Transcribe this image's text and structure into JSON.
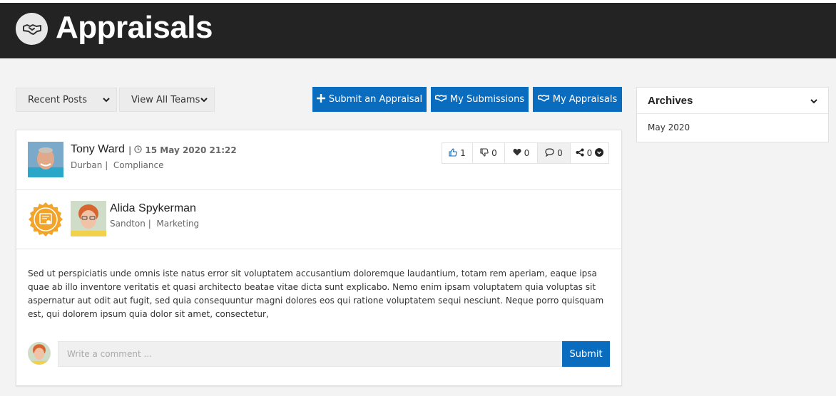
{
  "header": {
    "title": "Appraisals",
    "logo_icon": "handshake-icon",
    "background": "#232323"
  },
  "filters": {
    "posts_select": {
      "value": "Recent Posts"
    },
    "teams_select": {
      "value": "View All Teams"
    }
  },
  "actions": {
    "submit_appraisal": {
      "label": "Submit an Appraisal",
      "icon": "plus-icon"
    },
    "my_submissions": {
      "label": "My Submissions",
      "icon": "handshake-icon"
    },
    "my_appraisals": {
      "label": "My Appraisals",
      "icon": "handshake-icon"
    },
    "accent": "#0a6cbf"
  },
  "post": {
    "author": {
      "name": "Tony Ward",
      "separator": "|",
      "location": "Durban",
      "department": "Compliance"
    },
    "date": "15 May 2020 21:22",
    "reactions": {
      "like": {
        "count": "1",
        "icon": "thumbs-up-icon"
      },
      "dislike": {
        "count": "0",
        "icon": "thumbs-down-icon"
      },
      "love": {
        "count": "0",
        "icon": "heart-icon"
      },
      "comments": {
        "count": "0",
        "icon": "comment-icon"
      },
      "shares": {
        "count": "0",
        "icon": "share-icon"
      }
    },
    "recipient": {
      "name": "Alida Spykerman",
      "location": "Sandton",
      "department": "Marketing",
      "badge_icon": "award-badge-icon"
    },
    "body": "Sed ut perspiciatis unde omnis iste natus error sit voluptatem accusantium doloremque laudantium, totam rem aperiam, eaque ipsa quae ab illo inventore veritatis et quasi architecto beatae vitae dicta sunt explicabo. Nemo enim ipsam voluptatem quia voluptas sit aspernatur aut odit aut fugit, sed quia consequuntur magni dolores eos qui ratione voluptatem sequi nesciunt. Neque porro quisquam est, qui dolorem ipsum quia dolor sit amet, consectetur,",
    "comment": {
      "placeholder": "Write a comment ...",
      "submit_label": "Submit"
    }
  },
  "archives": {
    "title": "Archives",
    "items": [
      "May 2020"
    ]
  }
}
